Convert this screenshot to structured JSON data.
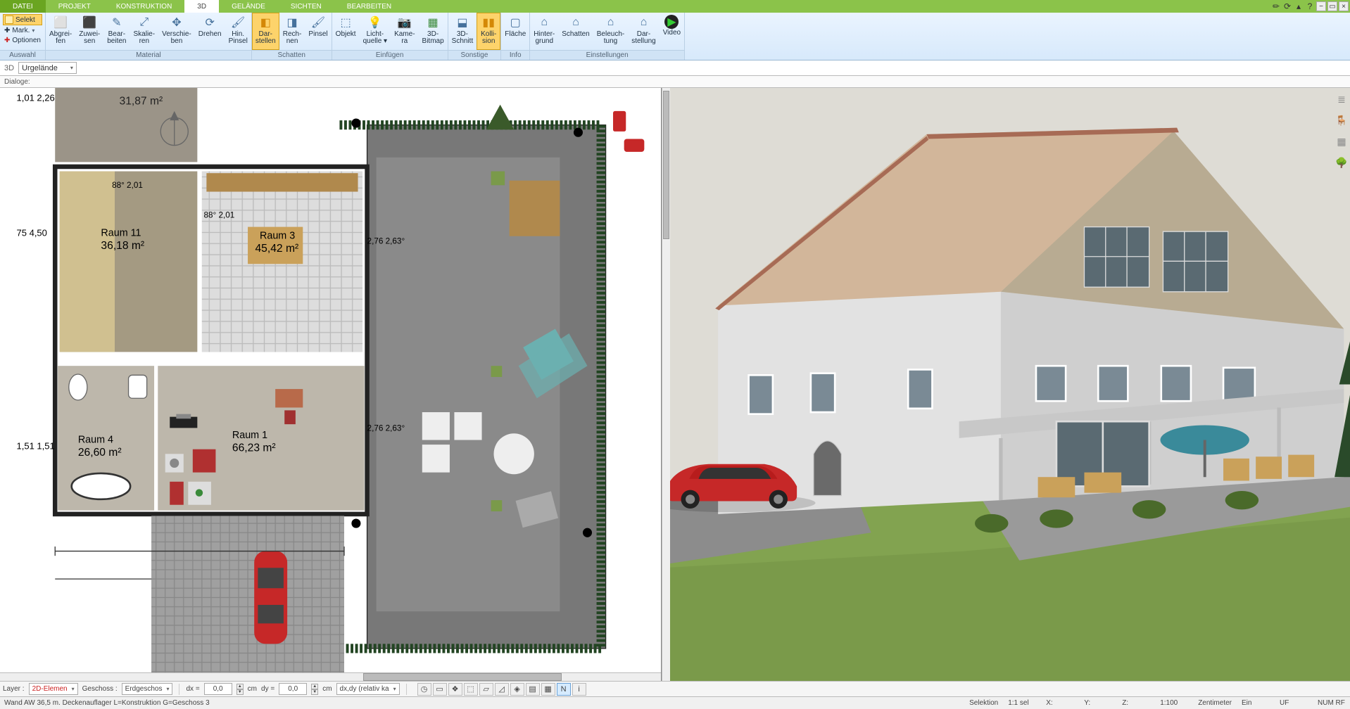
{
  "tabs": {
    "datei": "DATEI",
    "projekt": "PROJEKT",
    "konstruktion": "KONSTRUKTION",
    "drei_d": "3D",
    "gelaende": "GELÄNDE",
    "sichten": "SICHTEN",
    "bearbeiten": "BEARBEITEN"
  },
  "auswahl": {
    "selekt": "Selekt",
    "mark": "Mark.",
    "optionen": "Optionen",
    "label": "Auswahl"
  },
  "material": {
    "abgreifen": "Abgrei-\nfen",
    "zuweisen": "Zuwei-\nsen",
    "bearbeiten": "Bear-\nbeiten",
    "skalieren": "Skalie-\nren",
    "verschieben": "Verschie-\nben",
    "drehen": "Drehen",
    "hinpinsel": "Hin.\nPinsel",
    "label": "Material"
  },
  "schatten": {
    "darstellen": "Dar-\nstellen",
    "rechnen": "Rech-\nnen",
    "pinsel": "Pinsel",
    "label": "Schatten"
  },
  "einfuegen": {
    "objekt": "Objekt",
    "lichtquelle": "Licht-\nquelle ▾",
    "kamera": "Kame-\nra",
    "dreidbitmap": "3D-\nBitmap",
    "label": "Einfügen"
  },
  "sonstige": {
    "dreidschnitt": "3D-\nSchnitt",
    "kollision": "Kolli-\nsion",
    "label": "Sonstige"
  },
  "info": {
    "flaeche": "Fläche",
    "label": "Info"
  },
  "einstellungen": {
    "hintergrund": "Hinter-\ngrund",
    "schatten": "Schatten",
    "beleuchtung": "Beleuch-\ntung",
    "darstellung": "Dar-\nstellung",
    "video": "Video",
    "label": "Einstellungen"
  },
  "viewbar": {
    "viewlbl": "3D",
    "combo": "Urgelände"
  },
  "dlgbar": {
    "label": "Dialoge:"
  },
  "plan_rooms": {
    "r2_area": "31,87 m²",
    "r11_name": "Raum 11",
    "r11_area": "36,18 m²",
    "r3_name": "Raum 3",
    "r3_area": "45,42 m²",
    "r4_name": "Raum 4",
    "r4_area": "26,60 m²",
    "r1_name": "Raum 1",
    "r1_area": "66,23 m²",
    "dim_a": "88°\n2,01",
    "dim_b": "88°\n2,01",
    "dim_c": "2,76\n2,63°",
    "dim_d": "2,76\n2,63°",
    "left1": "1,01\n2,26",
    "left2": "75\n4,50",
    "left3": "1,51\n1,51"
  },
  "bottom": {
    "layer_lbl": "Layer :",
    "layer_val": "2D-Elemen",
    "geschoss_lbl": "Geschoss :",
    "geschoss_val": "Erdgeschos",
    "dx_lbl": "dx =",
    "dx_val": "0,0",
    "cm1": "cm",
    "dy_lbl": "dy =",
    "dy_val": "0,0",
    "cm2": "cm",
    "coordmode": "dx,dy (relativ ka"
  },
  "status": {
    "left": "Wand AW 36,5 m. Deckenauflager  L=Konstruktion  G=Geschoss 3",
    "selektion": "Selektion",
    "sel": "1:1 sel",
    "x": "X:",
    "y": "Y:",
    "z": "Z:",
    "scale": "1:100",
    "unit": "Zentimeter",
    "ein": "Ein",
    "uf": "UF",
    "num": "NUM RF"
  }
}
